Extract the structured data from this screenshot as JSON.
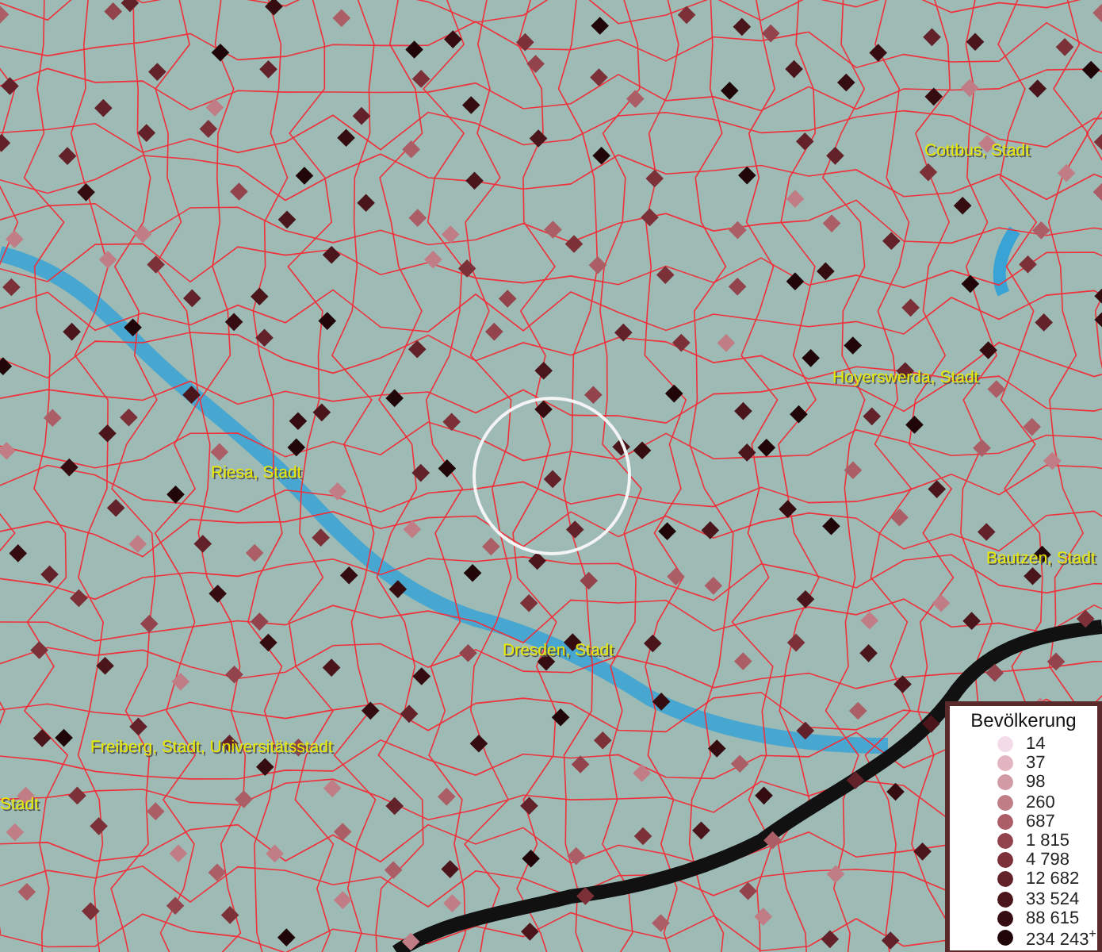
{
  "map": {
    "places": [
      {
        "name": "Cottbus, Stadt"
      },
      {
        "name": "Hoyerswerda, Stadt"
      },
      {
        "name": "Riesa, Stadt"
      },
      {
        "name": "Bautzen, Stadt"
      },
      {
        "name": "Dresden, Stadt"
      },
      {
        "name": "Freiberg, Stadt, Universitätsstadt"
      },
      {
        "name": "Stadt"
      }
    ]
  },
  "legend": {
    "title": "Bevölkerung",
    "entries": [
      {
        "label": "14",
        "color": "#f4dbe8"
      },
      {
        "label": "37",
        "color": "#e3b5c0"
      },
      {
        "label": "98",
        "color": "#d29aa3"
      },
      {
        "label": "260",
        "color": "#c07d86"
      },
      {
        "label": "687",
        "color": "#ab5e66"
      },
      {
        "label": "1 815",
        "color": "#92434b"
      },
      {
        "label": "4 798",
        "color": "#7c3038"
      },
      {
        "label": "12 682",
        "color": "#63222a"
      },
      {
        "label": "33 524",
        "color": "#4a161c"
      },
      {
        "label": "88 615",
        "color": "#350c10"
      },
      {
        "label": "234 243$^{+}$",
        "color": "#200608"
      }
    ]
  }
}
